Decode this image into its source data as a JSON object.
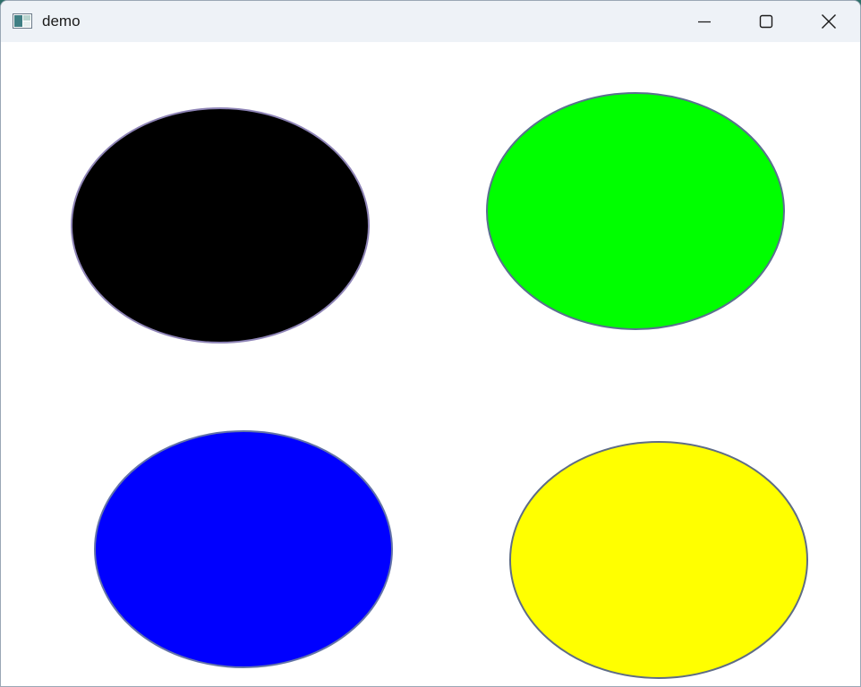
{
  "window": {
    "title": "demo"
  },
  "titlebar": {
    "icons": {
      "app": "app-window-icon",
      "minimize": "minimize-icon",
      "maximize": "maximize-icon",
      "close": "close-icon"
    }
  },
  "shapes": [
    {
      "name": "black-ellipse",
      "fill": "#000000",
      "stroke": "#8e84b6"
    },
    {
      "name": "green-ellipse",
      "fill": "#00ff00",
      "stroke": "#5a6f8f"
    },
    {
      "name": "blue-ellipse",
      "fill": "#0000ff",
      "stroke": "#6474a8"
    },
    {
      "name": "yellow-ellipse",
      "fill": "#ffff00",
      "stroke": "#5e6c86"
    }
  ]
}
